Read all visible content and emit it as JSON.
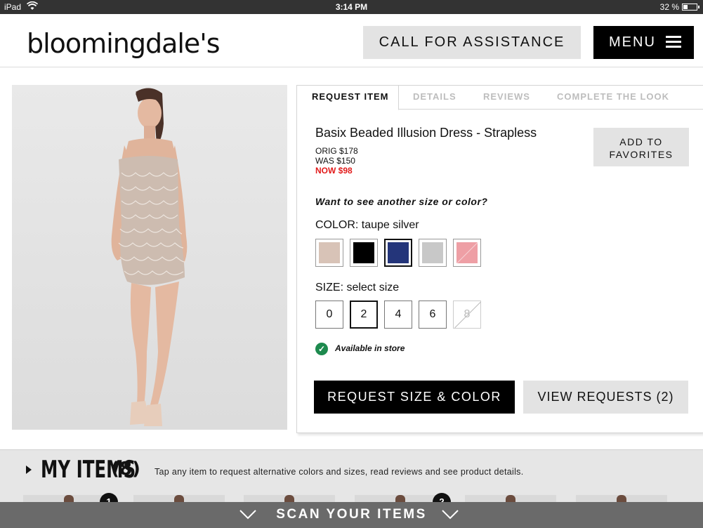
{
  "status_bar": {
    "device": "iPad",
    "time": "3:14 PM",
    "battery": "32 %"
  },
  "header": {
    "logo": "bloomingdale's",
    "call_label": "CALL FOR ASSISTANCE",
    "menu_label": "MENU"
  },
  "tabs": [
    "REQUEST ITEM",
    "DETAILS",
    "REVIEWS",
    "COMPLETE THE LOOK"
  ],
  "product": {
    "title": "Basix Beaded Illusion Dress - Strapless",
    "orig_price": "ORIG $178",
    "was_price": "WAS $150",
    "now_price": "NOW $98",
    "favorites_label_line1": "ADD TO",
    "favorites_label_line2": "FAVORITES",
    "prompt": "Want to see another size or color?",
    "color_label": "COLOR: taupe silver",
    "colors": [
      "#d8c3b7",
      "#000000",
      "#24357a",
      "#c8c8c8",
      "#ee9fa5"
    ],
    "size_label": "SIZE: select size",
    "sizes": [
      "0",
      "2",
      "4",
      "6",
      "8"
    ],
    "availability": "Available in store",
    "request_label": "REQUEST SIZE & COLOR",
    "view_requests_label": "VIEW REQUESTS  (2)"
  },
  "my_items": {
    "title": "MY ITEMS",
    "count": "(8)",
    "hint": "Tap any item to request alternative colors and sizes, read reviews and see product details.",
    "badges": [
      "1",
      "2"
    ]
  },
  "scan_bar": {
    "label": "SCAN YOUR ITEMS"
  }
}
